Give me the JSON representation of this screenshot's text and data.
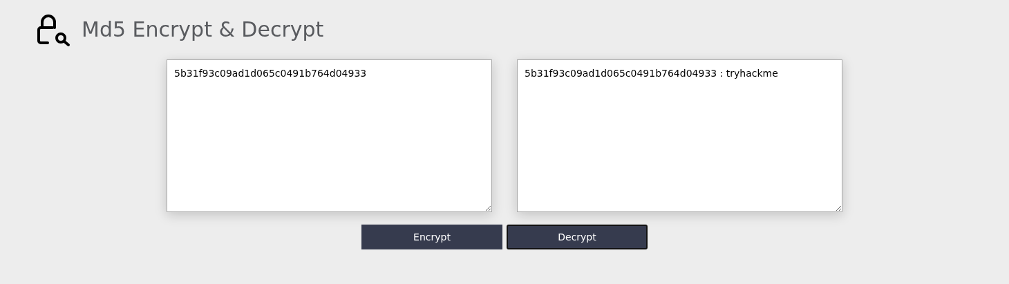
{
  "header": {
    "title": "Md5 Encrypt & Decrypt"
  },
  "input": {
    "value": "5b31f93c09ad1d065c0491b764d04933"
  },
  "output": {
    "value": "5b31f93c09ad1d065c0491b764d04933 : tryhackme"
  },
  "buttons": [
    {
      "label": "Encrypt",
      "focused": false
    },
    {
      "label": "Decrypt",
      "focused": true
    }
  ]
}
